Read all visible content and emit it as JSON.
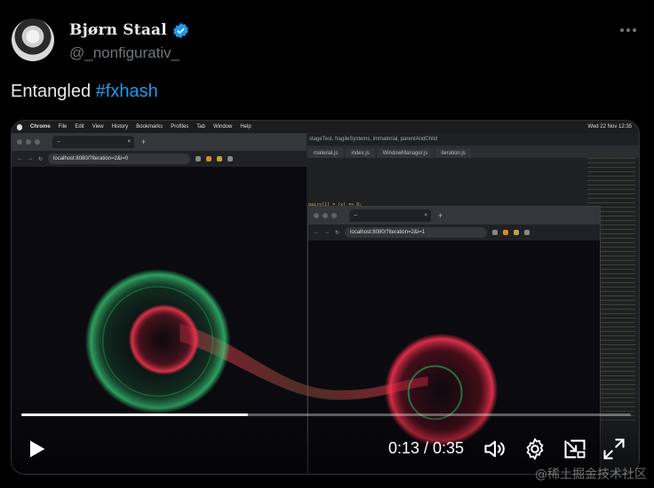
{
  "author": {
    "display_name": "Bjørn Staal",
    "handle": "@_nonfigurativ_",
    "verified": true,
    "avatar_icon": "avatar-photo"
  },
  "tweet": {
    "text": "Entangled ",
    "hashtag": "#fxhash"
  },
  "media": {
    "menubar": {
      "app": "Chrome",
      "items": [
        "File",
        "Edit",
        "View",
        "History",
        "Bookmarks",
        "Profiles",
        "Tab",
        "Window",
        "Help"
      ],
      "clock": "Wed 22 Nov 12:35"
    },
    "left_browser": {
      "tab_title": "--",
      "url": "localhost:8080/?iteration=2&i=0"
    },
    "right_browser": {
      "tab_title": "--",
      "url": "localhost:8080/?iteration=2&i=1"
    },
    "editor": {
      "breadcrumb": "stageTest, fragileSystems, immaterial, parentAndChild",
      "tabs": [
        "material.js",
        "index.js",
        "WindowManager.js",
        "iteration.js"
      ],
      "code_snippet": "pairs[1] = (x) => 0;"
    },
    "player": {
      "current_time": "0:13",
      "duration": "0:35",
      "time_display": "0:13 / 0:35",
      "progress": 0.3714,
      "play_icon": "play-icon",
      "volume_icon": "volume-icon",
      "settings_icon": "gear-icon",
      "pip_icon": "pip-icon",
      "fullscreen_icon": "fullscreen-icon"
    },
    "colors": {
      "green_orb": "#2fbf6a",
      "red_orb": "#e0243c"
    }
  },
  "watermark": "@稀土掘金技术社区",
  "more_icon": "more-icon",
  "colors": {
    "accent": "#1d9bf0",
    "handle": "#71767b"
  }
}
